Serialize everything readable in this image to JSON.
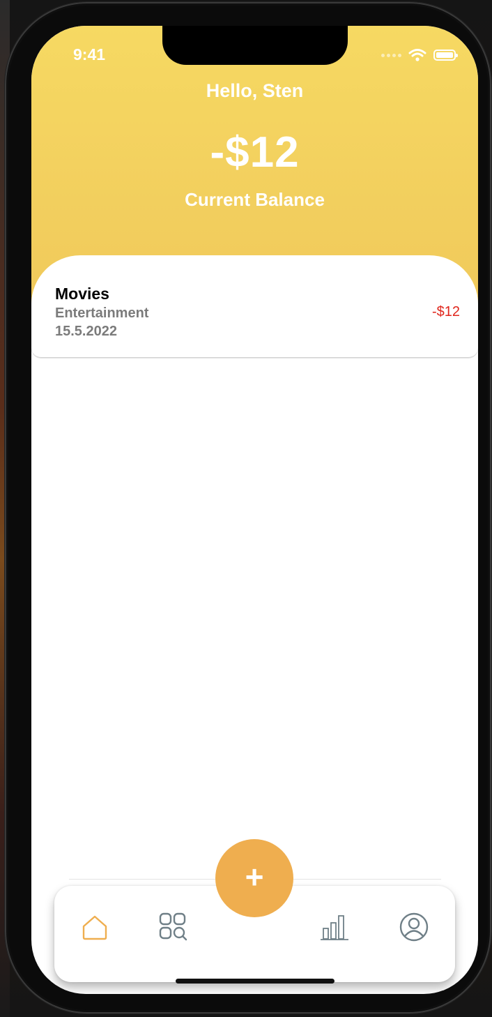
{
  "status_bar": {
    "time": "9:41"
  },
  "header": {
    "greeting": "Hello, Sten",
    "balance": "-$12",
    "balance_label": "Current Balance"
  },
  "transactions": [
    {
      "title": "Movies",
      "category": "Entertainment",
      "date": "15.5.2022",
      "amount": "-$12"
    }
  ],
  "tabbar": {
    "add_label": "+",
    "tabs": [
      {
        "icon": "home-icon",
        "active": true
      },
      {
        "icon": "categories-search-icon",
        "active": false
      },
      {
        "icon": "bar-chart-icon",
        "active": false
      },
      {
        "icon": "profile-icon",
        "active": false
      }
    ]
  },
  "colors": {
    "header": "#f4d35f",
    "accent": "#efae4f",
    "negative": "#e0261c",
    "icon_inactive": "#6f7f87"
  }
}
